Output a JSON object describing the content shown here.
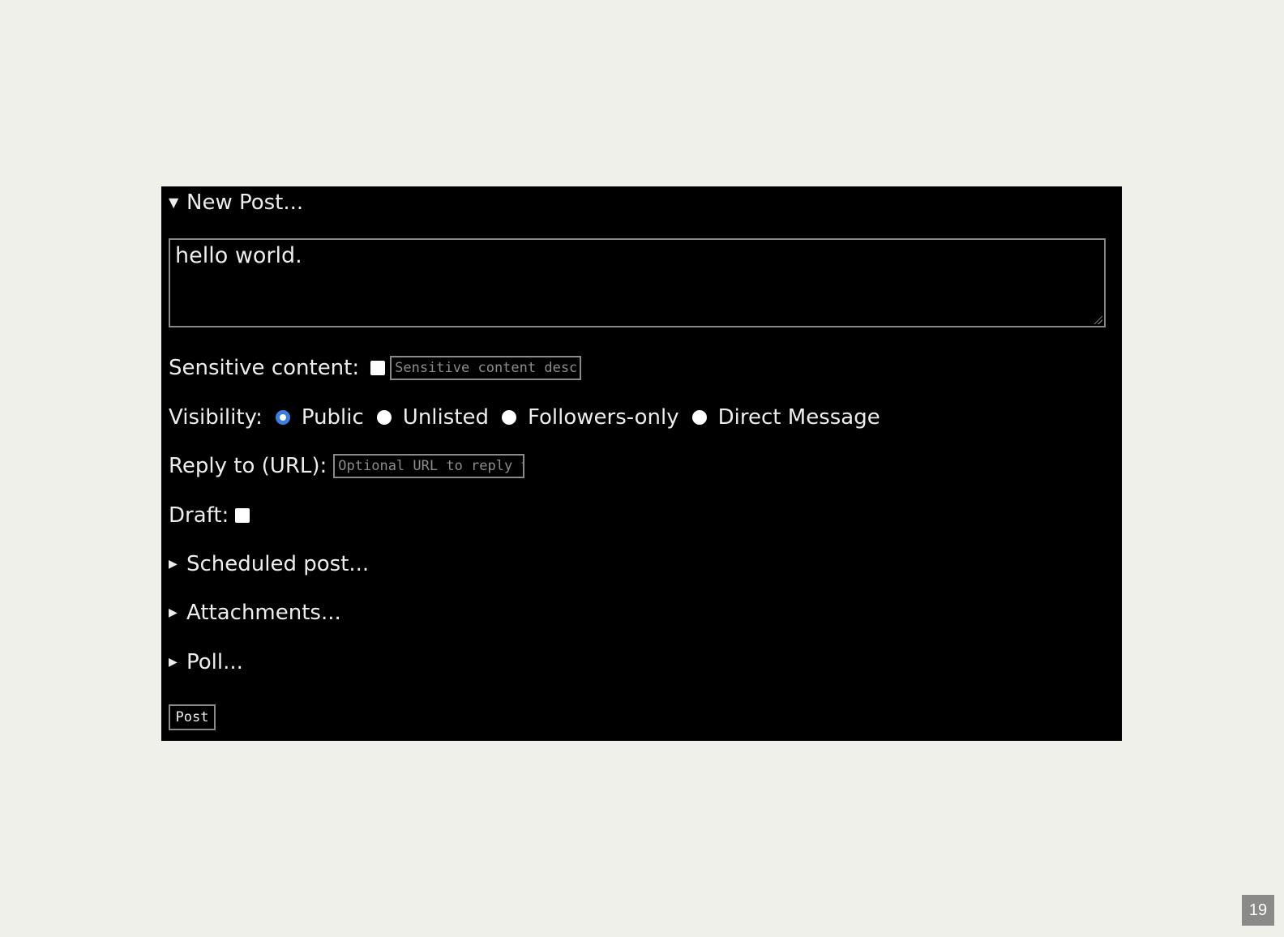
{
  "form": {
    "summary": "New Post...",
    "content": "hello world.",
    "sensitive_label": "Sensitive content:",
    "sensitive_placeholder": "Sensitive content descr",
    "visibility_label": "Visibility:",
    "visibility_options": [
      {
        "label": "Public",
        "checked": true
      },
      {
        "label": "Unlisted",
        "checked": false
      },
      {
        "label": "Followers-only",
        "checked": false
      },
      {
        "label": "Direct Message",
        "checked": false
      }
    ],
    "reply_label": "Reply to (URL):",
    "reply_placeholder": "Optional URL to reply t",
    "draft_label": "Draft:",
    "scheduled_summary": "Scheduled post...",
    "attachments_summary": "Attachments...",
    "poll_summary": "Poll...",
    "post_button": "Post"
  },
  "colors": {
    "background": "#f0f0eb",
    "panel": "#000000",
    "text": "#ededed",
    "radio_accent": "#3a7ee0",
    "input_border": "#8a8a8a"
  },
  "icons": {
    "expanded": "triangle-down-icon",
    "collapsed": "triangle-right-icon"
  },
  "slide": {
    "page_number": "19"
  }
}
